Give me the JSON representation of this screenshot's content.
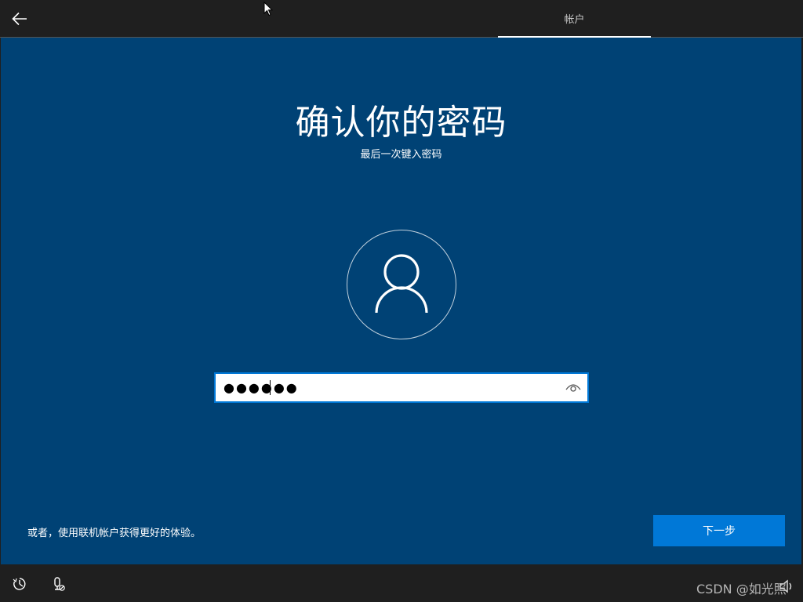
{
  "header": {
    "tab_account": "帐户"
  },
  "main": {
    "title": "确认你的密码",
    "subtitle": "最后一次键入密码",
    "password": {
      "masked_value": "●●●●●●",
      "reveal_icon": "eye-icon"
    },
    "online_link": "或者，使用联机帐户获得更好的体验。",
    "next_button": "下一步"
  },
  "footer": {
    "icons": [
      "ease-of-access-icon",
      "microphone-muted-icon",
      "volume-icon"
    ]
  },
  "watermark": "CSDN @如光照",
  "colors": {
    "main_bg": "#004275",
    "accent": "#0078d7",
    "bar_bg": "#1f1f1f"
  }
}
